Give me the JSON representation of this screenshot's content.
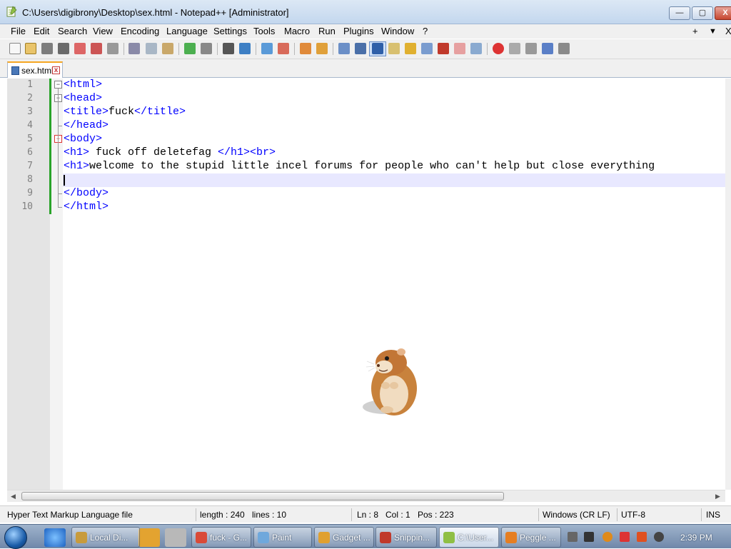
{
  "window": {
    "title": "C:\\Users\\digibrony\\Desktop\\sex.html - Notepad++ [Administrator]",
    "minimize_label": "—",
    "maximize_label": "▢",
    "close_label": "X"
  },
  "menu": {
    "items": [
      "File",
      "Edit",
      "Search",
      "View",
      "Encoding",
      "Language",
      "Settings",
      "Tools",
      "Macro",
      "Run",
      "Plugins",
      "Window",
      "?"
    ],
    "plus_label": "+",
    "arrow_label": "▼",
    "close_label": "X"
  },
  "tab": {
    "name": "sex.html",
    "close_label": "x"
  },
  "editor": {
    "line_numbers": [
      "1",
      "2",
      "3",
      "4",
      "5",
      "6",
      "7",
      "8",
      "9",
      "10"
    ],
    "lines": [
      [
        {
          "t": "tag",
          "v": "<html>"
        }
      ],
      [
        {
          "t": "tag",
          "v": "<head>"
        }
      ],
      [
        {
          "t": "tag",
          "v": "<title>"
        },
        {
          "t": "txt",
          "v": "fuck"
        },
        {
          "t": "tag",
          "v": "</title>"
        }
      ],
      [
        {
          "t": "tag",
          "v": "</head>"
        }
      ],
      [
        {
          "t": "tag",
          "v": "<body>"
        }
      ],
      [
        {
          "t": "tag",
          "v": "<h1>"
        },
        {
          "t": "txt",
          "v": " fuck off deletefag "
        },
        {
          "t": "tag",
          "v": "</h1><br>"
        }
      ],
      [
        {
          "t": "tag",
          "v": "<h1>"
        },
        {
          "t": "txt",
          "v": "welcome to the stupid little incel forums for people who can't help but close everything"
        }
      ],
      [],
      [
        {
          "t": "tag",
          "v": "</body>"
        }
      ],
      [
        {
          "t": "tag",
          "v": "</html>"
        }
      ]
    ]
  },
  "status": {
    "file_type": "Hyper Text Markup Language file",
    "length": "length : 240",
    "lines": "lines : 10",
    "ln": "Ln : 8",
    "col": "Col : 1",
    "pos": "Pos : 223",
    "eol": "Windows (CR LF)",
    "encoding": "UTF-8",
    "mode": "INS"
  },
  "taskbar": {
    "buttons": [
      {
        "label": "Local Di...",
        "icon": "folder-icon",
        "color": "#c89b3c"
      },
      {
        "label": "fuck - G...",
        "icon": "chrome-icon",
        "color": "#d94a38"
      },
      {
        "label": "Paint",
        "icon": "paint-icon",
        "color": "#6fa8dc"
      },
      {
        "label": "Gadget ...",
        "icon": "gadget-icon",
        "color": "#e0a030"
      },
      {
        "label": "Snippin...",
        "icon": "scissors-icon",
        "color": "#c0392b"
      },
      {
        "label": "C:\\User...",
        "icon": "notepad-icon",
        "color": "#8fbf45"
      },
      {
        "label": "Peggle ...",
        "icon": "peggle-icon",
        "color": "#e67e22"
      }
    ],
    "clock": "2:39 PM"
  },
  "colors": {
    "tag": "#0000ff",
    "text": "#000000",
    "current_line": "#e8e8ff",
    "change_bar": "#2aa32a"
  }
}
